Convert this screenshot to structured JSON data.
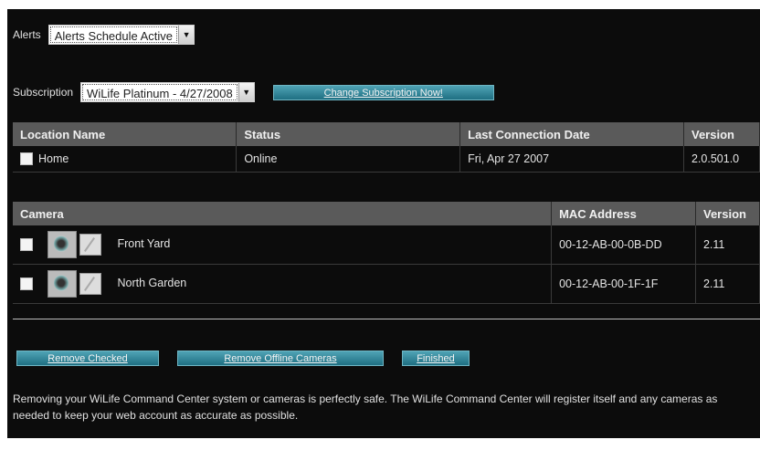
{
  "alerts": {
    "label": "Alerts",
    "selected": "Alerts Schedule Active"
  },
  "subscription": {
    "label": "Subscription",
    "selected": "WiLife Platinum - 4/27/2008",
    "change_button": "Change Subscription Now!"
  },
  "locations": {
    "headers": [
      "Location Name",
      "Status",
      "Last Connection Date",
      "Version"
    ],
    "rows": [
      {
        "name": "Home",
        "status": "Online",
        "last_connection": "Fri, Apr 27 2007",
        "version": "2.0.501.0"
      }
    ]
  },
  "cameras": {
    "headers": [
      "Camera",
      "MAC Address",
      "Version"
    ],
    "rows": [
      {
        "name": "Front Yard",
        "mac": "00-12-AB-00-0B-DD",
        "version": "2.11"
      },
      {
        "name": "North Garden",
        "mac": "00-12-AB-00-1F-1F",
        "version": "2.11"
      }
    ]
  },
  "actions": {
    "remove_checked": "Remove Checked",
    "remove_offline": "Remove Offline Cameras",
    "finished": "Finished"
  },
  "note": "Removing your WiLife Command Center system or cameras is perfectly safe. The WiLife Command Center will register itself and any cameras as needed to keep your web account as accurate as possible.",
  "colors": {
    "background": "#0c0c0c",
    "header": "#5a5a5a",
    "button": "#2f8599"
  }
}
